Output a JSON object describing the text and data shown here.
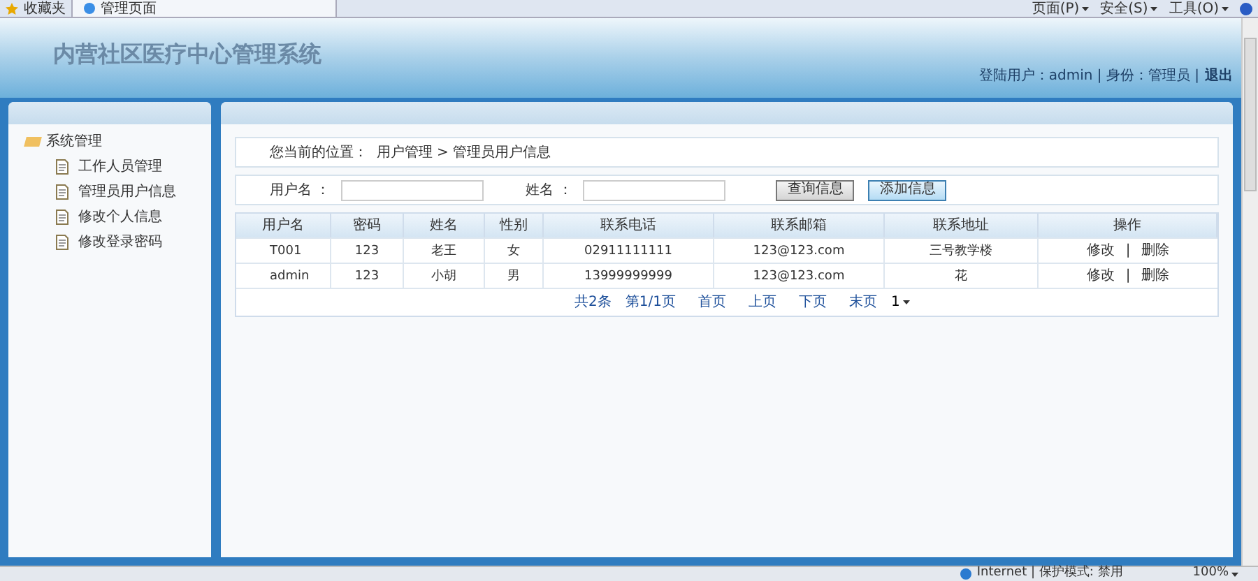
{
  "browser": {
    "favorites": "收藏夹",
    "tab": "管理页面",
    "menus": [
      "页面(P)",
      "安全(S)",
      "工具(O)"
    ]
  },
  "header": {
    "title": "内营社区医疗中心管理系统",
    "info": "登陆用户：admin | 身份：管理员 |",
    "logout": "退出"
  },
  "sidebar": {
    "group": "系统管理",
    "expanded": true,
    "items": [
      {
        "label": "工作人员管理"
      },
      {
        "label": "管理员用户信息"
      },
      {
        "label": "修改个人信息"
      },
      {
        "label": "修改登录密码"
      }
    ]
  },
  "breadcrumb": "您当前的位置：  用户管理 > 管理员用户信息",
  "search": {
    "fields": [
      {
        "label": "用户名 ："
      },
      {
        "label": "姓名 ："
      }
    ],
    "buttons": [
      {
        "label": "查询信息",
        "hovered": false
      },
      {
        "label": "添加信息",
        "hovered": true
      }
    ]
  },
  "table": {
    "columns": [
      "用户名",
      "密码",
      "姓名",
      "性别",
      "联系电话",
      "联系邮箱",
      "联系地址",
      "操作"
    ],
    "action_separator": "|",
    "rows": [
      {
        "cells": [
          "T001",
          "123",
          "老王",
          "女",
          "02911111111",
          "123@123.com",
          "三号教学楼"
        ],
        "actions": [
          "修改",
          "删除"
        ]
      },
      {
        "cells": [
          "admin",
          "123",
          "小胡",
          "男",
          "13999999999",
          "123@123.com",
          "花"
        ],
        "actions": [
          "修改",
          "删除"
        ]
      }
    ]
  },
  "pagination": {
    "total": "共2条",
    "page": "第1/1页",
    "links": [
      "首页",
      "上页",
      "下页",
      "末页"
    ],
    "select": "1"
  },
  "status_bar": {
    "zone": "Internet | 保护模式: 禁用",
    "zoom": "100%"
  }
}
